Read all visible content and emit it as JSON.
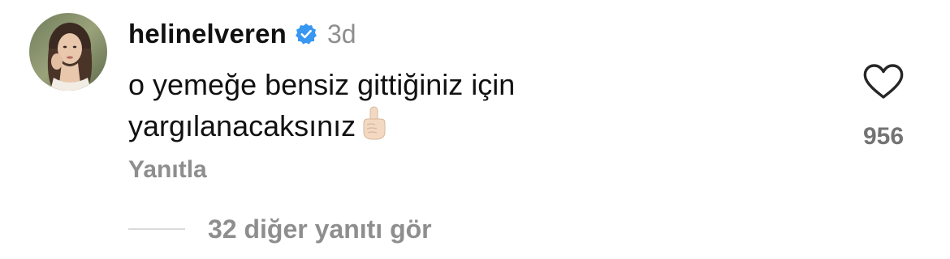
{
  "comment": {
    "username": "helinelveren",
    "verified_icon": "verified-badge-icon",
    "time": "3d",
    "text_line1": "o yemeğe bensiz gittiğiniz için",
    "text_line2": "yargılanacaksınız",
    "emoji_icon": "pointing-up-finger-emoji",
    "reply_label": "Yanıtla",
    "like_icon": "heart-outline-icon",
    "like_count": "956",
    "view_replies_label": "32 diğer yanıtı gör"
  },
  "colors": {
    "verified_blue": "#3897f0",
    "secondary_text": "#8e8e8e",
    "primary_text": "#111111"
  }
}
